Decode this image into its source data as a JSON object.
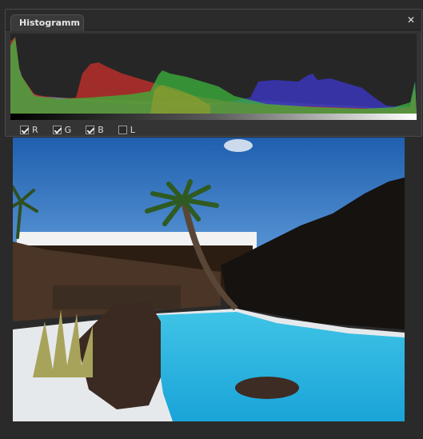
{
  "histogram_panel": {
    "tab_title": "Histogramm",
    "close_symbol": "✕",
    "channels": [
      {
        "label": "R",
        "checked": true
      },
      {
        "label": "G",
        "checked": true
      },
      {
        "label": "B",
        "checked": true
      },
      {
        "label": "L",
        "checked": false
      }
    ],
    "colors": {
      "red": "#c0302c",
      "green": "#3cb43c",
      "blue": "#3a35b4",
      "luminance": "#9fb3c8"
    }
  },
  "photo": {
    "scene": "palm-tree-lagoon-icon"
  }
}
